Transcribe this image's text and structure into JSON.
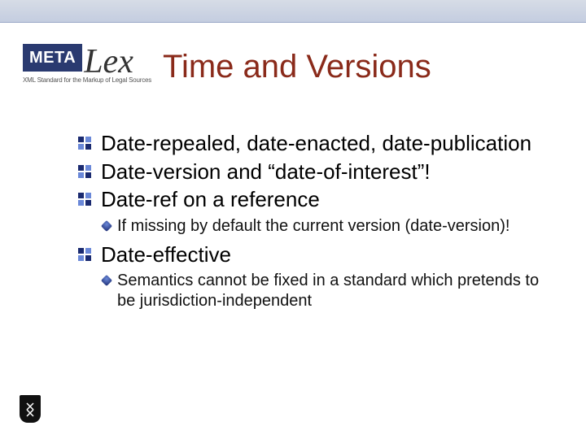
{
  "logo": {
    "meta": "META",
    "lex": "Lex",
    "tagline": "XML Standard for the Markup of Legal Sources"
  },
  "title": "Time and Versions",
  "bullets": [
    {
      "text": "Date-repealed, date-enacted, date-publication",
      "children": []
    },
    {
      "text": "Date-version and “date-of-interest”!",
      "children": []
    },
    {
      "text": "Date-ref on a reference",
      "children": [
        "If missing by default the current version (date-version)!"
      ]
    },
    {
      "text": "Date-effective",
      "children": [
        "Semantics cannot be fixed in a standard which pretends to be jurisdiction-independent"
      ]
    }
  ]
}
